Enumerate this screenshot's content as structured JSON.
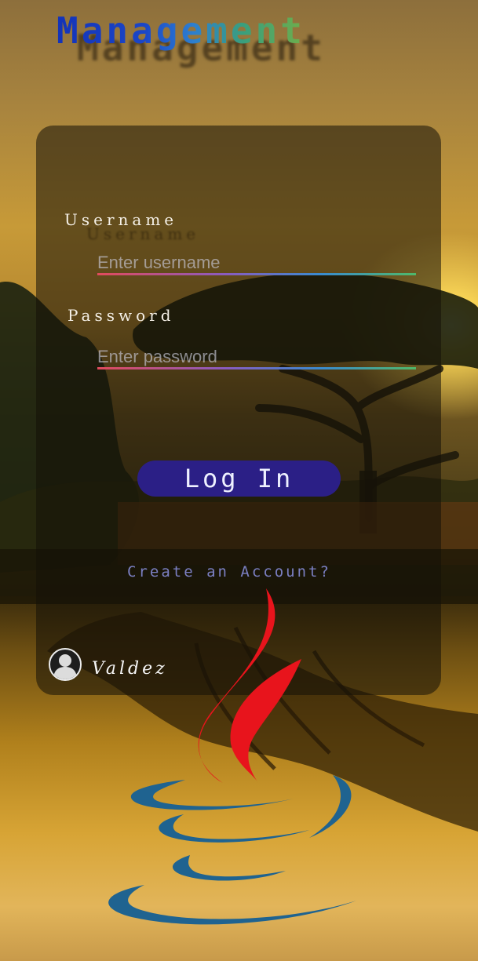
{
  "app": {
    "title": "Management"
  },
  "login_form": {
    "username_label": "Username",
    "username_placeholder": "Enter username",
    "username_value": "",
    "password_label": "Password",
    "password_placeholder": "Enter password",
    "password_value": "",
    "login_button_label": "Log In",
    "create_account_label": "Create an Account?"
  },
  "footer": {
    "author_name": "Valdez",
    "avatar_icon": "user-avatar-icon",
    "logo_icon": "java-logo-icon"
  },
  "colors": {
    "button_bg": "#2b1f86",
    "link_color": "#7b7fc2",
    "java_red": "#e8141c",
    "java_blue": "#1f6390"
  }
}
